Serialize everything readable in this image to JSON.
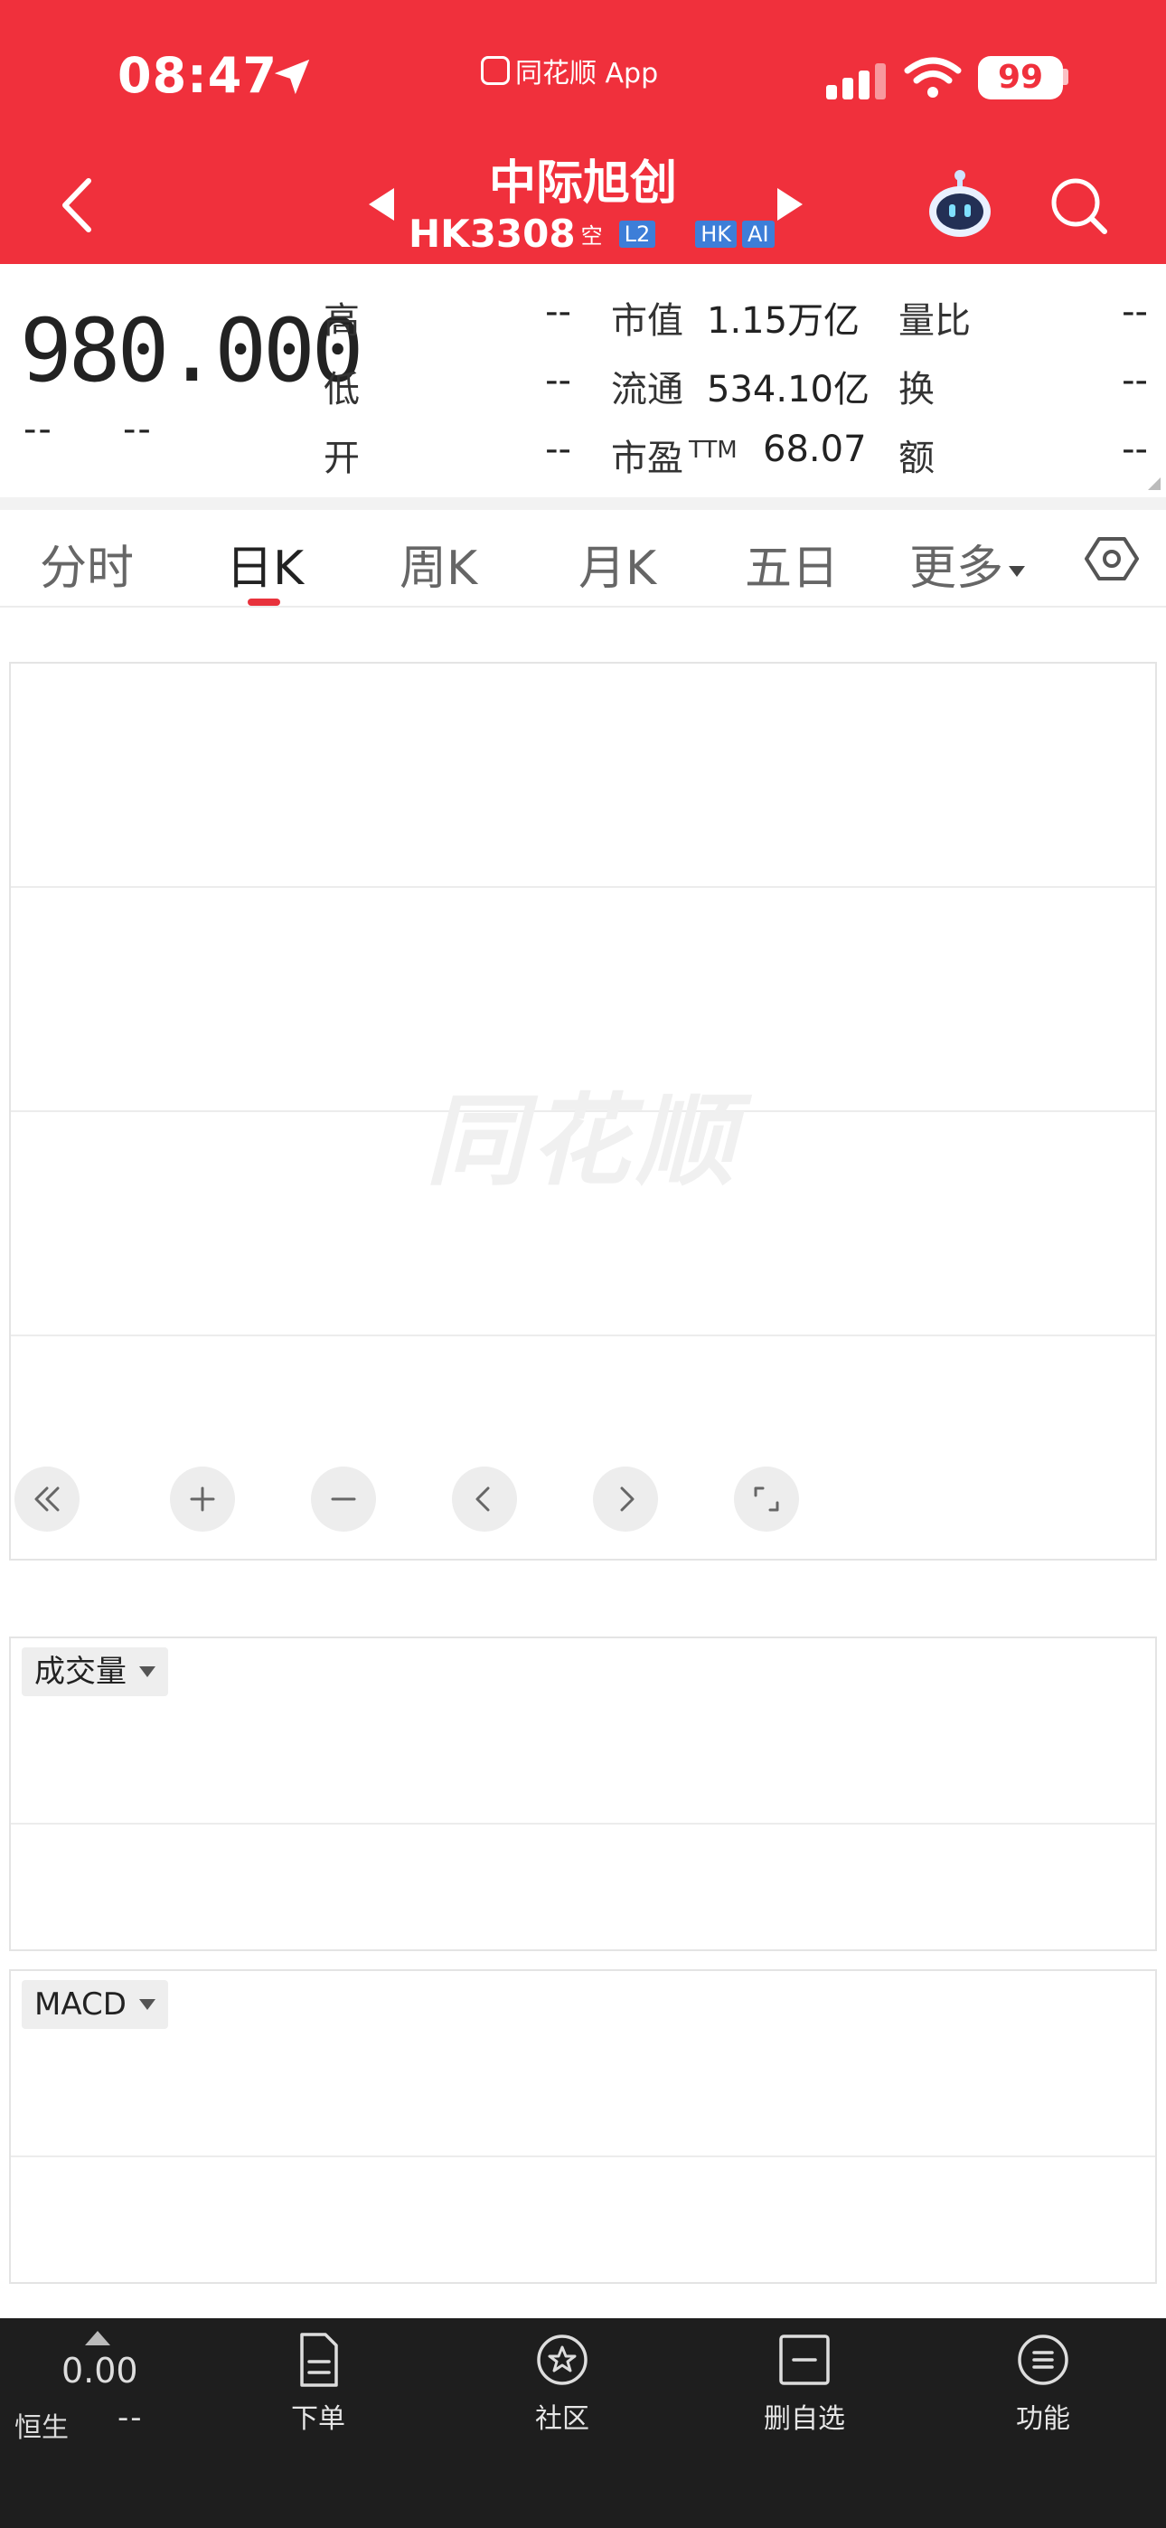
{
  "status_bar": {
    "time": "08:47",
    "app": "同花顺 App",
    "battery": "99"
  },
  "header": {
    "stock_name": "中际旭创",
    "stock_code": "HK3308",
    "short_tag": "空",
    "badges": [
      "L2",
      "HK",
      "AI"
    ]
  },
  "quote": {
    "price": "980.000",
    "change": "--",
    "change_pct": "--",
    "high_label": "高",
    "high_value": "--",
    "low_label": "低",
    "low_value": "--",
    "open_label": "开",
    "open_value": "--",
    "mcap_label": "市值",
    "mcap_value": "1.15万亿",
    "float_label": "流通",
    "float_value": "534.10亿",
    "pe_label": "市盈",
    "pe_sup": "TTM",
    "pe_value": "68.07",
    "vr_label": "量比",
    "vr_value": "--",
    "turnover_label": "换",
    "turnover_value": "--",
    "amount_label": "额",
    "amount_value": "--"
  },
  "tabs": {
    "items": [
      "分时",
      "日K",
      "周K",
      "月K",
      "五日"
    ],
    "more": "更多",
    "active": "日K"
  },
  "chart": {
    "watermark": "同花顺"
  },
  "indicators": {
    "volume": "成交量",
    "macd": "MACD"
  },
  "bottom_bar": {
    "index_value": "0.00",
    "index_name": "恒生",
    "index_change": "--",
    "nav": [
      "下单",
      "社区",
      "删自选",
      "功能"
    ]
  }
}
